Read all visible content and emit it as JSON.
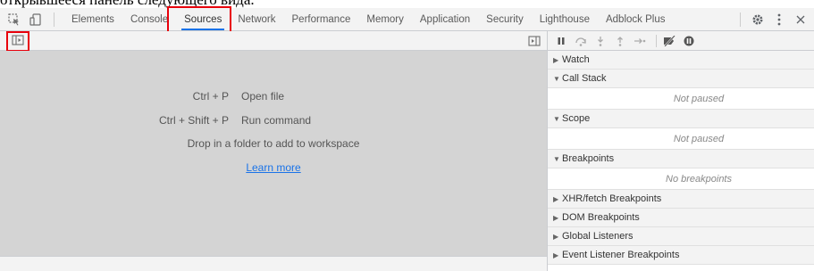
{
  "caption": {
    "text": "открывшееся панель следующего вида."
  },
  "tabs": [
    {
      "label": "Elements",
      "active": false
    },
    {
      "label": "Console",
      "active": false
    },
    {
      "label": "Sources",
      "active": true
    },
    {
      "label": "Network",
      "active": false
    },
    {
      "label": "Performance",
      "active": false
    },
    {
      "label": "Memory",
      "active": false
    },
    {
      "label": "Application",
      "active": false
    },
    {
      "label": "Security",
      "active": false
    },
    {
      "label": "Lighthouse",
      "active": false
    },
    {
      "label": "Adblock Plus",
      "active": false
    }
  ],
  "toolbar_icons": {
    "inspect": "inspect-element-icon",
    "device": "device-toggle-icon",
    "settings": "gear-icon",
    "menu": "kebab-menu-icon",
    "close": "close-icon"
  },
  "sources": {
    "shortcuts": [
      {
        "keys": "Ctrl + P",
        "action": "Open file"
      },
      {
        "keys": "Ctrl + Shift + P",
        "action": "Run command"
      }
    ],
    "drop_text": "Drop in a folder to add to workspace",
    "learn_more": "Learn more"
  },
  "debugger": {
    "sections": [
      {
        "title": "Watch",
        "expanded": false,
        "body": ""
      },
      {
        "title": "Call Stack",
        "expanded": true,
        "body": "Not paused"
      },
      {
        "title": "Scope",
        "expanded": true,
        "body": "Not paused"
      },
      {
        "title": "Breakpoints",
        "expanded": true,
        "body": "No breakpoints"
      },
      {
        "title": "XHR/fetch Breakpoints",
        "expanded": false,
        "body": ""
      },
      {
        "title": "DOM Breakpoints",
        "expanded": false,
        "body": ""
      },
      {
        "title": "Global Listeners",
        "expanded": false,
        "body": ""
      },
      {
        "title": "Event Listener Breakpoints",
        "expanded": false,
        "body": ""
      }
    ]
  },
  "colors": {
    "highlight": "#e8000b",
    "active_tab_underline": "#1a73e8",
    "link": "#1a73e8",
    "pane_bg": "#d4d4d4"
  }
}
